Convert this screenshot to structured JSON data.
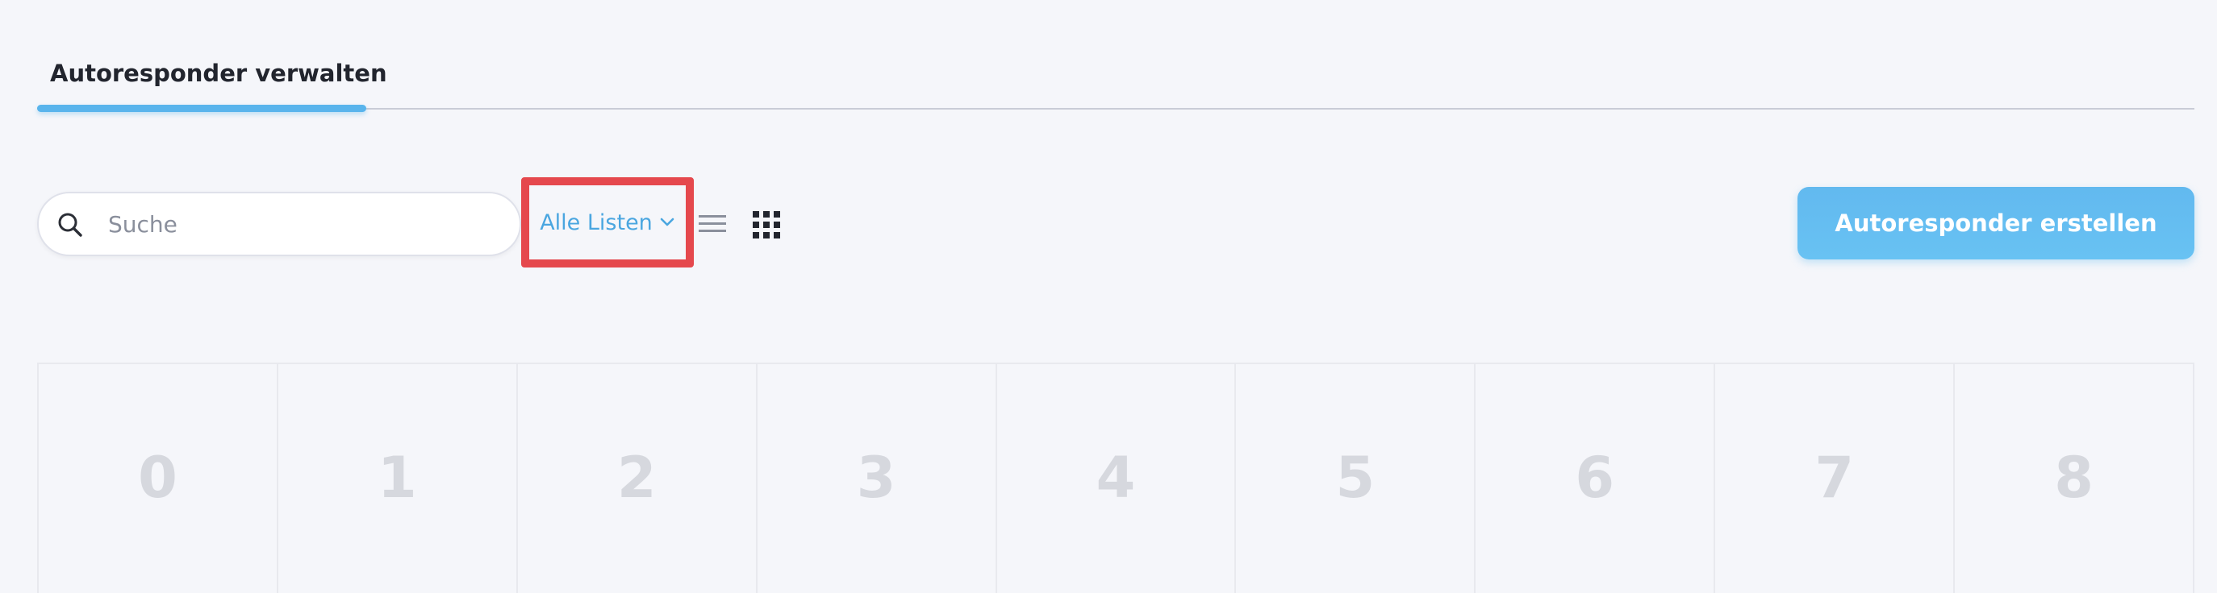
{
  "tabs": {
    "active_label": "Autoresponder verwalten"
  },
  "toolbar": {
    "search_placeholder": "Suche",
    "list_filter_label": "Alle Listen",
    "create_button_label": "Autoresponder erstellen",
    "icons": [
      "search-icon",
      "chevron-down-icon",
      "list-view-icon",
      "grid-view-icon"
    ]
  },
  "cells": [
    "0",
    "1",
    "2",
    "3",
    "4",
    "5",
    "6",
    "7",
    "8"
  ],
  "colors": {
    "accent": "#59b4ec",
    "link": "#4aa6e0",
    "highlight_border": "#e5484d",
    "background": "#f5f6fa",
    "placeholder_number": "#d6d8de"
  }
}
